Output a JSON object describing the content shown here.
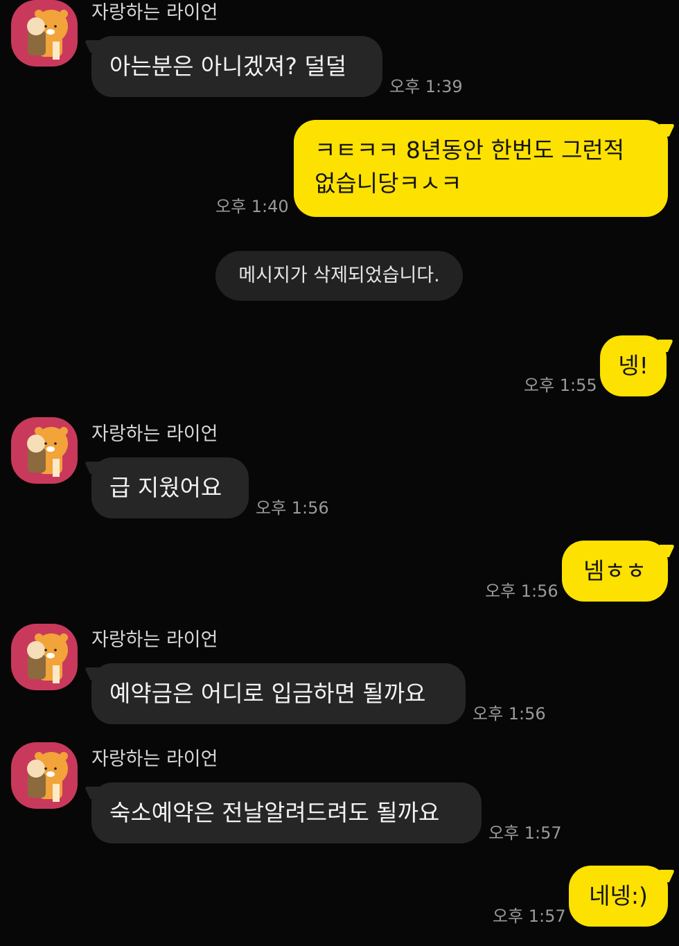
{
  "chat": {
    "messages": [
      {
        "type": "incoming",
        "sender": "자랑하는 라이언",
        "text": "아는분은 아니겠져? 덜덜",
        "time": "오후 1:39"
      },
      {
        "type": "outgoing",
        "text_lines": [
          "ㅋㅌㅋㅋ 8년동안 한번도 그런적",
          "없습니당ㅋㅅㅋ"
        ],
        "time": "오후 1:40"
      },
      {
        "type": "system",
        "text": "메시지가 삭제되었습니다."
      },
      {
        "type": "outgoing",
        "text": "넹!",
        "time": "오후 1:55"
      },
      {
        "type": "incoming",
        "sender": "자랑하는 라이언",
        "text": "급 지웠어요",
        "time": "오후 1:56"
      },
      {
        "type": "outgoing",
        "text": "넴ㅎㅎ",
        "time": "오후 1:56"
      },
      {
        "type": "incoming",
        "sender": "자랑하는 라이언",
        "text": "예약금은 어디로 입금하면 될까요",
        "time": "오후 1:56"
      },
      {
        "type": "incoming",
        "sender": "자랑하는 라이언",
        "text": "숙소예약은 전날알려드려도 될까요",
        "time": "오후 1:57"
      },
      {
        "type": "outgoing",
        "text": "네넹:)",
        "time": "오후 1:57"
      }
    ]
  },
  "colors": {
    "background": "#070707",
    "incoming_bubble": "#262626",
    "outgoing_bubble": "#fde101",
    "avatar_bg": "#c9395c",
    "timestamp": "#9a9a9a"
  },
  "icons": {
    "avatar": "ryan-character-icon"
  }
}
